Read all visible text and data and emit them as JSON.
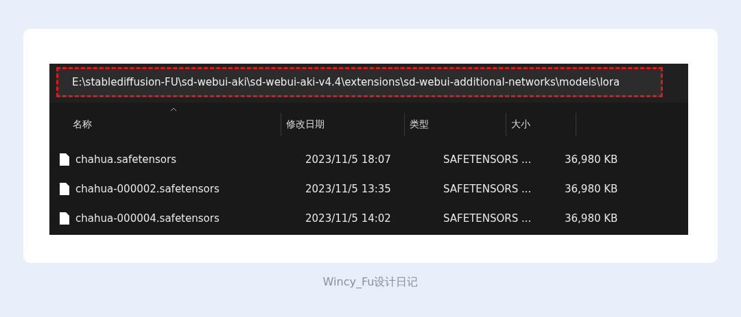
{
  "address_bar": {
    "path": "E:\\stablediffusion-FU\\sd-webui-aki\\sd-webui-aki-v4.4\\extensions\\sd-webui-additional-networks\\models\\lora",
    "highlighted": true
  },
  "columns": [
    {
      "label": "名称",
      "sorted": true
    },
    {
      "label": "修改日期",
      "sorted": false
    },
    {
      "label": "类型",
      "sorted": false
    },
    {
      "label": "大小",
      "sorted": false
    }
  ],
  "files": [
    {
      "name": "chahua.safetensors",
      "modified": "2023/11/5 18:07",
      "type": "SAFETENSORS ...",
      "size": "36,980 KB"
    },
    {
      "name": "chahua-000002.safetensors",
      "modified": "2023/11/5 13:35",
      "type": "SAFETENSORS ...",
      "size": "36,980 KB"
    },
    {
      "name": "chahua-000004.safetensors",
      "modified": "2023/11/5 14:02",
      "type": "SAFETENSORS ...",
      "size": "36,980 KB"
    }
  ],
  "caption": "Wincy_Fu设计日记"
}
